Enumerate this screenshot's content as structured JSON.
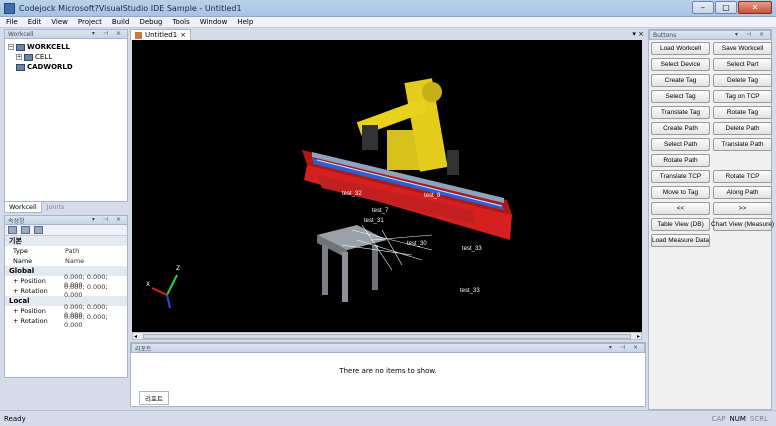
{
  "window": {
    "title": "Codejock Microsoft?VisualStudio IDE Sample - Untitled1",
    "controls": [
      "–",
      "▢",
      "✕"
    ]
  },
  "menu": [
    "File",
    "Edit",
    "View",
    "Project",
    "Build",
    "Debug",
    "Tools",
    "Window",
    "Help"
  ],
  "workcell": {
    "header": "Workcell",
    "tree": [
      {
        "label": "WORKCELL",
        "bold": true,
        "expander": "−"
      },
      {
        "label": "CELL",
        "bold": false,
        "expander": "+"
      },
      {
        "label": "CADWORLD",
        "bold": true,
        "expander": ""
      }
    ],
    "tabs": [
      "Workcell",
      "Joints"
    ]
  },
  "properties": {
    "header": "속성창",
    "rows": [
      {
        "cat": "기본"
      },
      {
        "k": "Type",
        "v": "Path"
      },
      {
        "k": "Name",
        "v": "Name"
      },
      {
        "cat": "Global"
      },
      {
        "k": "Position",
        "v": "0.000; 0.000; 0.000",
        "exp": "+"
      },
      {
        "k": "Rotation",
        "v": "0.000; 0.000; 0.000",
        "exp": "+"
      },
      {
        "cat": "Local"
      },
      {
        "k": "Position",
        "v": "0.000; 0.000; 0.000",
        "exp": "+"
      },
      {
        "k": "Rotation",
        "v": "0.000; 0.000; 0.000",
        "exp": "+"
      }
    ]
  },
  "document": {
    "tab_label": "Untitled1",
    "tab_close": "×",
    "ctl": "▾ ×"
  },
  "viewport": {
    "labels": [
      "test_32",
      "test_7",
      "test_31",
      "test_30",
      "test_33",
      "test_33",
      "test_8"
    ]
  },
  "report": {
    "header": "리포트",
    "empty_text": "There are no items to show.",
    "tab": "리포트"
  },
  "buttons_panel": {
    "header": "Buttons",
    "buttons": [
      "Load Workcell",
      "Save Workcell",
      "Select Device",
      "Select Part",
      "Create Tag",
      "Delete Tag",
      "Select Tag",
      "Tag on TCP",
      "Translate Tag",
      "Rotate Tag",
      "Create Path",
      "Delete Path",
      "Select Path",
      "Translate Path",
      "Rotate Path",
      "",
      "Translate TCP",
      "Rotate TCP",
      "Move to Tag",
      "Along Path",
      "<<",
      ">>",
      "Table View (DB)",
      "Chart View (Measure)",
      "Load Measure Data",
      ""
    ]
  },
  "status": {
    "left": "Ready",
    "indicators": [
      "CAP",
      "NUM",
      "SCRL"
    ],
    "active": [
      "NUM"
    ]
  }
}
